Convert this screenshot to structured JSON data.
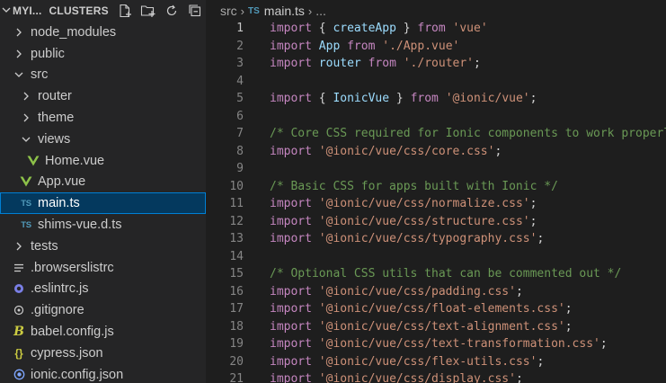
{
  "explorer": {
    "workspace": "MYI...",
    "section": "CLUSTERS",
    "actions": [
      "new-file-icon",
      "new-folder-icon",
      "refresh-icon",
      "collapse-all-icon"
    ]
  },
  "tree": [
    {
      "label": "node_modules",
      "depth": 1,
      "kind": "folder",
      "open": false,
      "icon": "chevron-right-icon"
    },
    {
      "label": "public",
      "depth": 1,
      "kind": "folder",
      "open": false,
      "icon": "chevron-right-icon"
    },
    {
      "label": "src",
      "depth": 1,
      "kind": "folder",
      "open": true,
      "icon": "chevron-down-icon"
    },
    {
      "label": "router",
      "depth": 2,
      "kind": "folder",
      "open": false,
      "icon": "chevron-right-icon"
    },
    {
      "label": "theme",
      "depth": 2,
      "kind": "folder",
      "open": false,
      "icon": "chevron-right-icon"
    },
    {
      "label": "views",
      "depth": 2,
      "kind": "folder",
      "open": true,
      "icon": "chevron-down-icon"
    },
    {
      "label": "Home.vue",
      "depth": 3,
      "kind": "file",
      "icon": "vue-icon"
    },
    {
      "label": "App.vue",
      "depth": 2,
      "kind": "file",
      "icon": "vue-icon"
    },
    {
      "label": "main.ts",
      "depth": 2,
      "kind": "file",
      "icon": "ts-icon",
      "selected": true
    },
    {
      "label": "shims-vue.d.ts",
      "depth": 2,
      "kind": "file",
      "icon": "ts-icon"
    },
    {
      "label": "tests",
      "depth": 1,
      "kind": "folder",
      "open": false,
      "icon": "chevron-right-icon"
    },
    {
      "label": ".browserslistrc",
      "depth": 1,
      "kind": "file",
      "icon": "list-icon"
    },
    {
      "label": ".eslintrc.js",
      "depth": 1,
      "kind": "file",
      "icon": "eslint-icon"
    },
    {
      "label": ".gitignore",
      "depth": 1,
      "kind": "file",
      "icon": "git-icon"
    },
    {
      "label": "babel.config.js",
      "depth": 1,
      "kind": "file",
      "icon": "js-icon"
    },
    {
      "label": "cypress.json",
      "depth": 1,
      "kind": "file",
      "icon": "json-icon"
    },
    {
      "label": "ionic.config.json",
      "depth": 1,
      "kind": "file",
      "icon": "ionic-icon"
    }
  ],
  "breadcrumb": {
    "folder": "src",
    "file_badge": "TS",
    "file": "main.ts",
    "more": "..."
  },
  "editor": {
    "active_line": 1,
    "lines": [
      {
        "n": "1",
        "tokens": [
          {
            "t": "kw",
            "v": "import"
          },
          {
            "t": "plain",
            "v": " { "
          },
          {
            "t": "id",
            "v": "createApp"
          },
          {
            "t": "plain",
            "v": " } "
          },
          {
            "t": "kw",
            "v": "from"
          },
          {
            "t": "plain",
            "v": " "
          },
          {
            "t": "str",
            "v": "'vue'"
          }
        ]
      },
      {
        "n": "2",
        "tokens": [
          {
            "t": "kw",
            "v": "import"
          },
          {
            "t": "plain",
            "v": " "
          },
          {
            "t": "id",
            "v": "App"
          },
          {
            "t": "plain",
            "v": " "
          },
          {
            "t": "kw",
            "v": "from"
          },
          {
            "t": "plain",
            "v": " "
          },
          {
            "t": "str",
            "v": "'./App.vue'"
          }
        ]
      },
      {
        "n": "3",
        "tokens": [
          {
            "t": "kw",
            "v": "import"
          },
          {
            "t": "plain",
            "v": " "
          },
          {
            "t": "id",
            "v": "router"
          },
          {
            "t": "plain",
            "v": " "
          },
          {
            "t": "kw",
            "v": "from"
          },
          {
            "t": "plain",
            "v": " "
          },
          {
            "t": "str",
            "v": "'./router'"
          },
          {
            "t": "plain",
            "v": ";"
          }
        ]
      },
      {
        "n": "4",
        "tokens": []
      },
      {
        "n": "5",
        "tokens": [
          {
            "t": "kw",
            "v": "import"
          },
          {
            "t": "plain",
            "v": " { "
          },
          {
            "t": "id",
            "v": "IonicVue"
          },
          {
            "t": "plain",
            "v": " } "
          },
          {
            "t": "kw",
            "v": "from"
          },
          {
            "t": "plain",
            "v": " "
          },
          {
            "t": "str",
            "v": "'@ionic/vue'"
          },
          {
            "t": "plain",
            "v": ";"
          }
        ]
      },
      {
        "n": "6",
        "tokens": []
      },
      {
        "n": "7",
        "tokens": [
          {
            "t": "cm",
            "v": "/* Core CSS required for Ionic components to work properly */"
          }
        ]
      },
      {
        "n": "8",
        "tokens": [
          {
            "t": "kw",
            "v": "import"
          },
          {
            "t": "plain",
            "v": " "
          },
          {
            "t": "str",
            "v": "'@ionic/vue/css/core.css'"
          },
          {
            "t": "plain",
            "v": ";"
          }
        ]
      },
      {
        "n": "9",
        "tokens": []
      },
      {
        "n": "10",
        "tokens": [
          {
            "t": "cm",
            "v": "/* Basic CSS for apps built with Ionic */"
          }
        ]
      },
      {
        "n": "11",
        "tokens": [
          {
            "t": "kw",
            "v": "import"
          },
          {
            "t": "plain",
            "v": " "
          },
          {
            "t": "str",
            "v": "'@ionic/vue/css/normalize.css'"
          },
          {
            "t": "plain",
            "v": ";"
          }
        ]
      },
      {
        "n": "12",
        "tokens": [
          {
            "t": "kw",
            "v": "import"
          },
          {
            "t": "plain",
            "v": " "
          },
          {
            "t": "str",
            "v": "'@ionic/vue/css/structure.css'"
          },
          {
            "t": "plain",
            "v": ";"
          }
        ]
      },
      {
        "n": "13",
        "tokens": [
          {
            "t": "kw",
            "v": "import"
          },
          {
            "t": "plain",
            "v": " "
          },
          {
            "t": "str",
            "v": "'@ionic/vue/css/typography.css'"
          },
          {
            "t": "plain",
            "v": ";"
          }
        ]
      },
      {
        "n": "14",
        "tokens": []
      },
      {
        "n": "15",
        "tokens": [
          {
            "t": "cm",
            "v": "/* Optional CSS utils that can be commented out */"
          }
        ]
      },
      {
        "n": "16",
        "tokens": [
          {
            "t": "kw",
            "v": "import"
          },
          {
            "t": "plain",
            "v": " "
          },
          {
            "t": "str",
            "v": "'@ionic/vue/css/padding.css'"
          },
          {
            "t": "plain",
            "v": ";"
          }
        ]
      },
      {
        "n": "17",
        "tokens": [
          {
            "t": "kw",
            "v": "import"
          },
          {
            "t": "plain",
            "v": " "
          },
          {
            "t": "str",
            "v": "'@ionic/vue/css/float-elements.css'"
          },
          {
            "t": "plain",
            "v": ";"
          }
        ]
      },
      {
        "n": "18",
        "tokens": [
          {
            "t": "kw",
            "v": "import"
          },
          {
            "t": "plain",
            "v": " "
          },
          {
            "t": "str",
            "v": "'@ionic/vue/css/text-alignment.css'"
          },
          {
            "t": "plain",
            "v": ";"
          }
        ]
      },
      {
        "n": "19",
        "tokens": [
          {
            "t": "kw",
            "v": "import"
          },
          {
            "t": "plain",
            "v": " "
          },
          {
            "t": "str",
            "v": "'@ionic/vue/css/text-transformation.css'"
          },
          {
            "t": "plain",
            "v": ";"
          }
        ]
      },
      {
        "n": "20",
        "tokens": [
          {
            "t": "kw",
            "v": "import"
          },
          {
            "t": "plain",
            "v": " "
          },
          {
            "t": "str",
            "v": "'@ionic/vue/css/flex-utils.css'"
          },
          {
            "t": "plain",
            "v": ";"
          }
        ]
      },
      {
        "n": "21",
        "tokens": [
          {
            "t": "kw",
            "v": "import"
          },
          {
            "t": "plain",
            "v": " "
          },
          {
            "t": "str",
            "v": "'@ionic/vue/css/display.css'"
          },
          {
            "t": "plain",
            "v": ";"
          }
        ]
      }
    ]
  },
  "colors": {
    "editor_bg": "#1e1e1e",
    "sidebar_bg": "#252526",
    "selection_bg": "#04395e",
    "selection_border": "#007fd4",
    "keyword": "#c586c0",
    "string": "#ce9178",
    "identifier": "#9cdcfe",
    "comment": "#6a9955"
  }
}
